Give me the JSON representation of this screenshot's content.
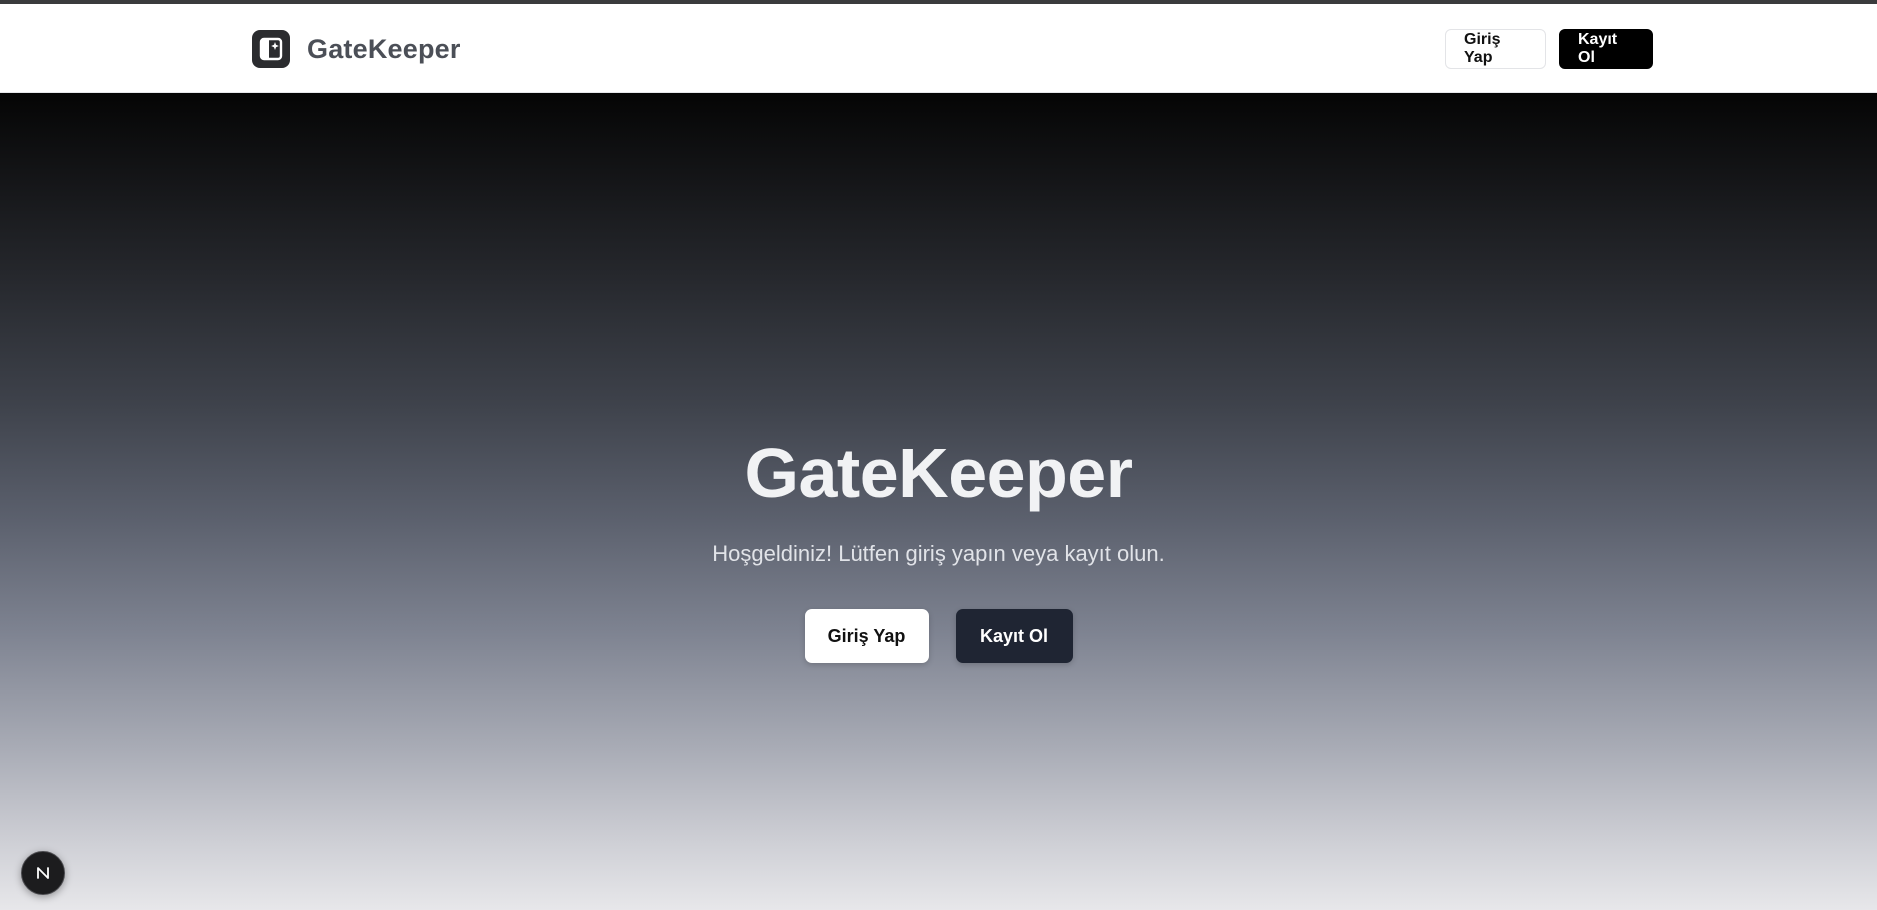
{
  "header": {
    "brand_name": "GateKeeper",
    "brand_icon": "layout-sparkle-icon",
    "login_label": "Giriş Yap",
    "register_label": "Kayıt Ol"
  },
  "hero": {
    "title": "GateKeeper",
    "subtitle": "Hoşgeldiniz! Lütfen giriş yapın veya kayıt olun.",
    "login_label": "Giriş Yap",
    "register_label": "Kayıt Ol"
  },
  "dev_badge": {
    "icon": "nextjs-icon"
  },
  "colors": {
    "primary": "#000000",
    "hero_register_button": "#1f2533",
    "brand_text": "#4b4f57"
  }
}
